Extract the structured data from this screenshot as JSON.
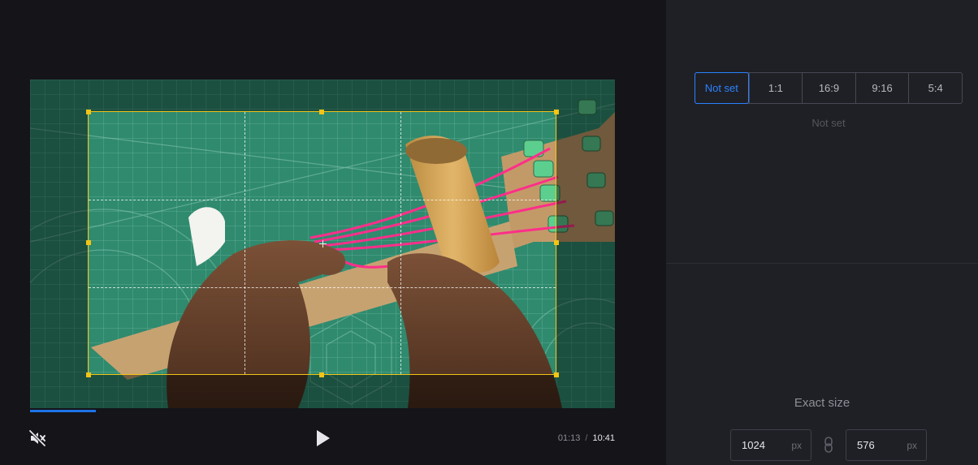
{
  "player": {
    "progress_fraction": 0.113,
    "current_time": "01:13",
    "separator": "/",
    "total_time": "10:41",
    "icons": {
      "mute": "volume-muted-icon",
      "play": "play-icon"
    }
  },
  "crop": {
    "grid": "rule-of-thirds",
    "frame_color": "#f2c416"
  },
  "aspect_ratio": {
    "options": [
      "Not set",
      "1:1",
      "16:9",
      "9:16",
      "5:4"
    ],
    "selected": "Not set",
    "caption": "Not set"
  },
  "exact_size": {
    "title": "Exact size",
    "width": "1024",
    "height": "576",
    "width_unit": "px",
    "height_unit": "px",
    "link_icon": "chain-link-icon"
  },
  "colors": {
    "accent": "#2a82ff",
    "progress": "#1e73e8",
    "background": "#141419",
    "panel": "#1f2026"
  }
}
